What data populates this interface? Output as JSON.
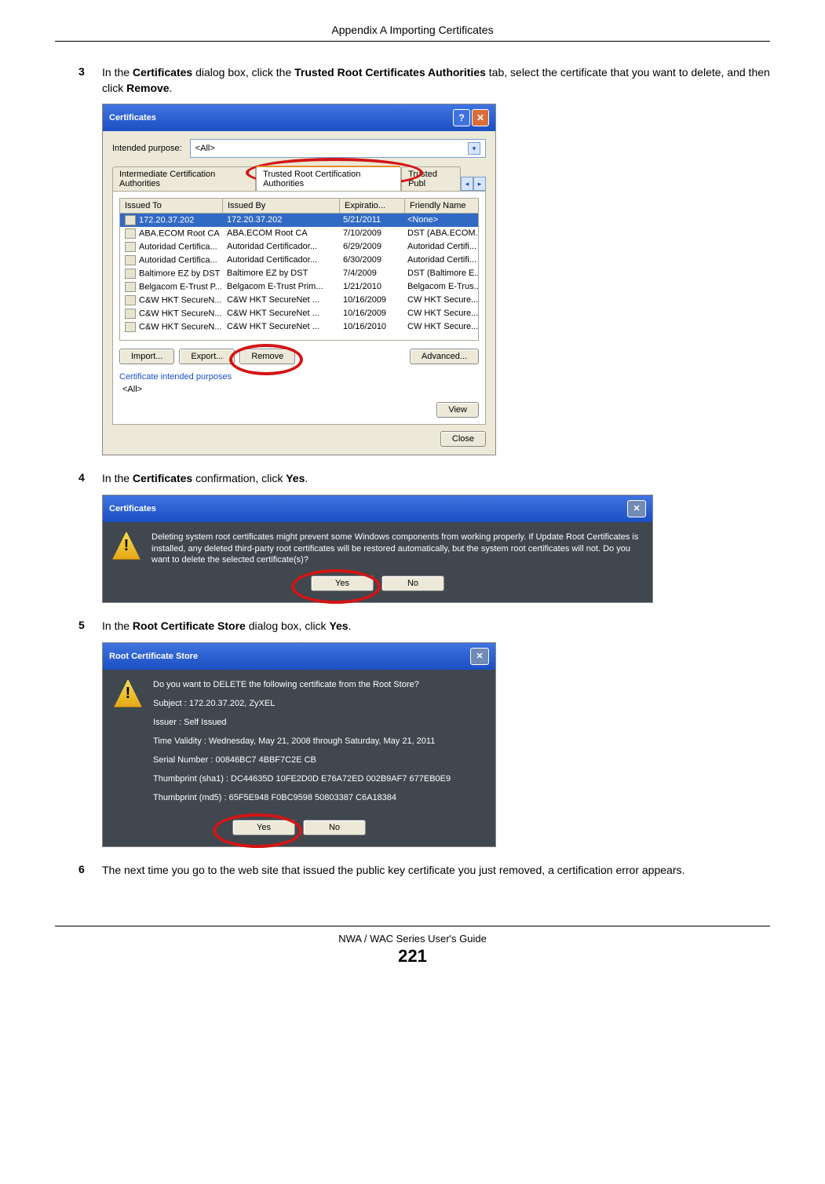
{
  "header": "Appendix A Importing Certificates",
  "step3": {
    "num": "3",
    "pre": "In the ",
    "b1": "Certificates",
    "mid1": " dialog box, click the ",
    "b2": "Trusted Root Certificates Authorities",
    "mid2": " tab, select the certificate that you want to delete, and then click ",
    "b3": "Remove",
    "post": "."
  },
  "dlg1": {
    "title": "Certificates",
    "help": "?",
    "close": "✕",
    "purpose_label": "Intended purpose:",
    "purpose_value": "<All>",
    "tabs": {
      "t1": "Intermediate Certification Authorities",
      "t2": "Trusted Root Certification Authorities",
      "t3_partial": "Trusted Publ"
    },
    "columns": {
      "c1": "Issued To",
      "c2": "Issued By",
      "c3": "Expiratio...",
      "c4": "Friendly Name"
    },
    "rows": [
      {
        "a": "172.20.37.202",
        "b": "172.20.37.202",
        "c": "5/21/2011",
        "d": "<None>",
        "sel": true
      },
      {
        "a": "ABA.ECOM Root CA",
        "b": "ABA.ECOM Root CA",
        "c": "7/10/2009",
        "d": "DST (ABA.ECOM..."
      },
      {
        "a": "Autoridad Certifica...",
        "b": "Autoridad Certificador...",
        "c": "6/29/2009",
        "d": "Autoridad Certifi..."
      },
      {
        "a": "Autoridad Certifica...",
        "b": "Autoridad Certificador...",
        "c": "6/30/2009",
        "d": "Autoridad Certifi..."
      },
      {
        "a": "Baltimore EZ by DST",
        "b": "Baltimore EZ by DST",
        "c": "7/4/2009",
        "d": "DST (Baltimore E..."
      },
      {
        "a": "Belgacom E-Trust P...",
        "b": "Belgacom E-Trust Prim...",
        "c": "1/21/2010",
        "d": "Belgacom E-Trus..."
      },
      {
        "a": "C&W HKT SecureN...",
        "b": "C&W HKT SecureNet ...",
        "c": "10/16/2009",
        "d": "CW HKT Secure..."
      },
      {
        "a": "C&W HKT SecureN...",
        "b": "C&W HKT SecureNet ...",
        "c": "10/16/2009",
        "d": "CW HKT Secure..."
      },
      {
        "a": "C&W HKT SecureN...",
        "b": "C&W HKT SecureNet ...",
        "c": "10/16/2010",
        "d": "CW HKT Secure..."
      }
    ],
    "buttons": {
      "import": "Import...",
      "export": "Export...",
      "remove": "Remove",
      "advanced": "Advanced..."
    },
    "group_label": "Certificate intended purposes",
    "group_value": "<All>",
    "view": "View",
    "close_btn": "Close"
  },
  "step4": {
    "num": "4",
    "pre": "In the ",
    "b1": "Certificates",
    "mid": " confirmation, click ",
    "b2": "Yes",
    "post": "."
  },
  "dlg2": {
    "title": "Certificates",
    "close": "✕",
    "text": "Deleting system root certificates might prevent some Windows components from working properly. If Update Root Certificates is installed, any deleted third-party root certificates will be restored automatically, but the system root certificates will not. Do you want to delete the selected certificate(s)?",
    "yes": "Yes",
    "no": "No"
  },
  "step5": {
    "num": "5",
    "pre": "In the ",
    "b1": "Root Certificate Store",
    "mid": " dialog box, click ",
    "b2": "Yes",
    "post": "."
  },
  "dlg3": {
    "title": "Root Certificate Store",
    "close": "✕",
    "q": "Do you want to DELETE the following certificate from the Root Store?",
    "l1": "Subject : 172.20.37.202, ZyXEL",
    "l2": "Issuer : Self Issued",
    "l3": "Time Validity : Wednesday, May 21, 2008 through Saturday, May 21, 2011",
    "l4": "Serial Number : 00846BC7 4BBF7C2E CB",
    "l5": "Thumbprint (sha1) : DC44635D 10FE2D0D E76A72ED 002B9AF7 677EB0E9",
    "l6": "Thumbprint (md5) : 65F5E948 F0BC9598 50803387 C6A18384",
    "yes": "Yes",
    "no": "No"
  },
  "step6": {
    "num": "6",
    "text": "The next time you go to the web site that issued the public key certificate you just removed, a certification error appears."
  },
  "footer": {
    "title": "NWA / WAC Series User's Guide",
    "page": "221"
  }
}
